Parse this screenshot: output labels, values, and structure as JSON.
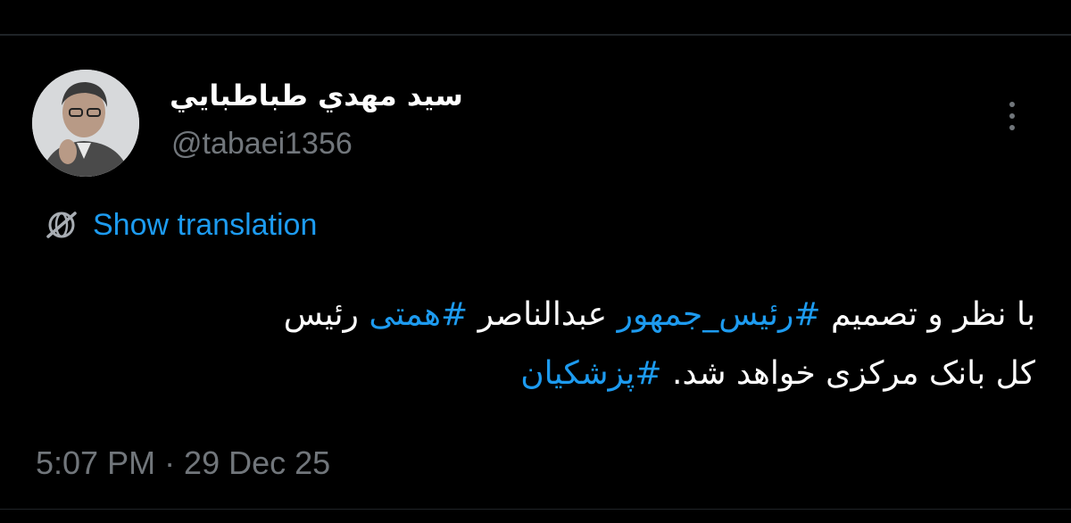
{
  "author": {
    "display_name": "سيد مهدي طباطبايي",
    "handle": "@tabaei1356"
  },
  "translate": {
    "label": "Show translation",
    "icon": "globe-translate-icon"
  },
  "more": {
    "icon": "more-vertical-icon"
  },
  "tweet": {
    "line1": {
      "t1": "با نظر و تصمیم ",
      "tag1": "#رئیس_جمهور",
      "t2": " عبدالناصر ",
      "tag2": "#همتی",
      "t3": " رئیس"
    },
    "line2": {
      "t1": "کل بانک مرکزی خواهد شد. ",
      "tag1": "#پزشکیان"
    }
  },
  "meta": {
    "timestamp": "5:07 PM · 29 Dec 25"
  },
  "colors": {
    "background": "#000000",
    "text": "#ffffff",
    "muted": "#71767b",
    "accent": "#1d9bf0"
  }
}
